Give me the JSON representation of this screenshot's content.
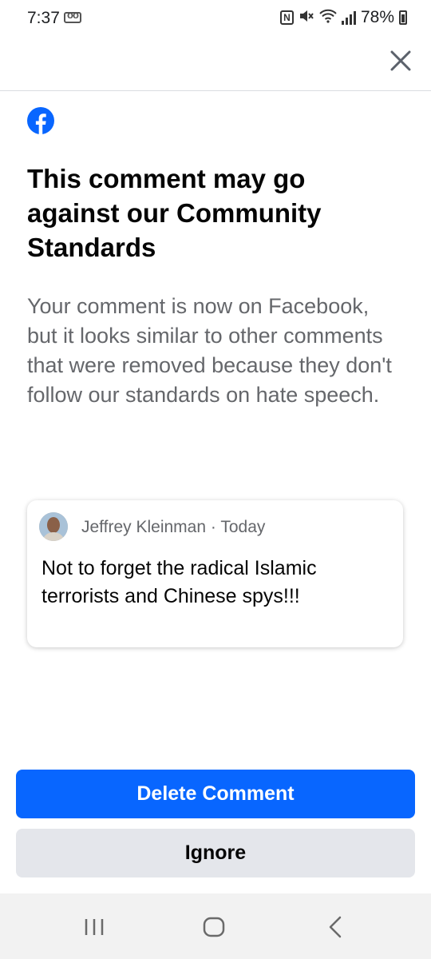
{
  "status_bar": {
    "time": "7:37",
    "battery": "78%",
    "icons": [
      "voicemail-icon",
      "nfc-icon",
      "mute-icon",
      "wifi-icon",
      "signal-icon",
      "battery-icon"
    ]
  },
  "top_bar": {
    "close_icon": "close-icon"
  },
  "brand": {
    "logo_icon": "facebook-logo-icon",
    "color": "#0866ff"
  },
  "dialog": {
    "title": "This comment may go against our Community Standards",
    "body": "Your comment is now on Facebook, but it looks similar to other comments that were removed because they don't follow our standards on hate speech."
  },
  "comment": {
    "author": "Jeffrey Kleinman",
    "separator": "·",
    "time": "Today",
    "text": "Not to forget the radical Islamic terrorists and Chinese spys!!!"
  },
  "actions": {
    "delete_label": "Delete Comment",
    "ignore_label": "Ignore"
  },
  "nav_bar": {
    "icons": [
      "recent-apps-icon",
      "home-icon",
      "back-icon"
    ]
  },
  "colors": {
    "primary": "#0866ff",
    "secondary_button": "#e4e6eb",
    "secondary_text": "#65676b"
  }
}
